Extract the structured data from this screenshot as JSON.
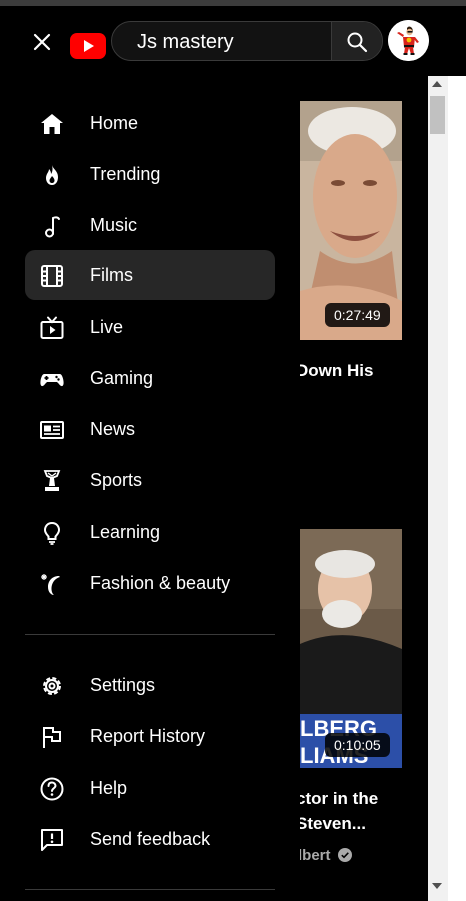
{
  "header": {
    "search_value": "Js mastery",
    "brand_color": "#ff0000"
  },
  "sidebar": {
    "primary": [
      {
        "label": "Home",
        "icon": "home-icon"
      },
      {
        "label": "Trending",
        "icon": "flame-icon"
      },
      {
        "label": "Music",
        "icon": "music-note-icon"
      },
      {
        "label": "Films",
        "icon": "film-icon",
        "active": true
      },
      {
        "label": "Live",
        "icon": "live-tv-icon"
      },
      {
        "label": "Gaming",
        "icon": "gamepad-icon"
      },
      {
        "label": "News",
        "icon": "newspaper-icon"
      },
      {
        "label": "Sports",
        "icon": "trophy-icon"
      },
      {
        "label": "Learning",
        "icon": "lightbulb-icon"
      },
      {
        "label": "Fashion & beauty",
        "icon": "hanger-icon"
      }
    ],
    "secondary": [
      {
        "label": "Settings",
        "icon": "gear-icon"
      },
      {
        "label": "Report History",
        "icon": "flag-icon"
      },
      {
        "label": "Help",
        "icon": "help-icon"
      },
      {
        "label": "Send feedback",
        "icon": "feedback-icon"
      }
    ]
  },
  "videos": [
    {
      "duration": "0:27:49",
      "title_lines": [
        "Down His"
      ]
    },
    {
      "duration": "0:10:05",
      "title_lines": [
        "ctor in the",
        "Steven..."
      ],
      "channel": "lbert"
    }
  ]
}
